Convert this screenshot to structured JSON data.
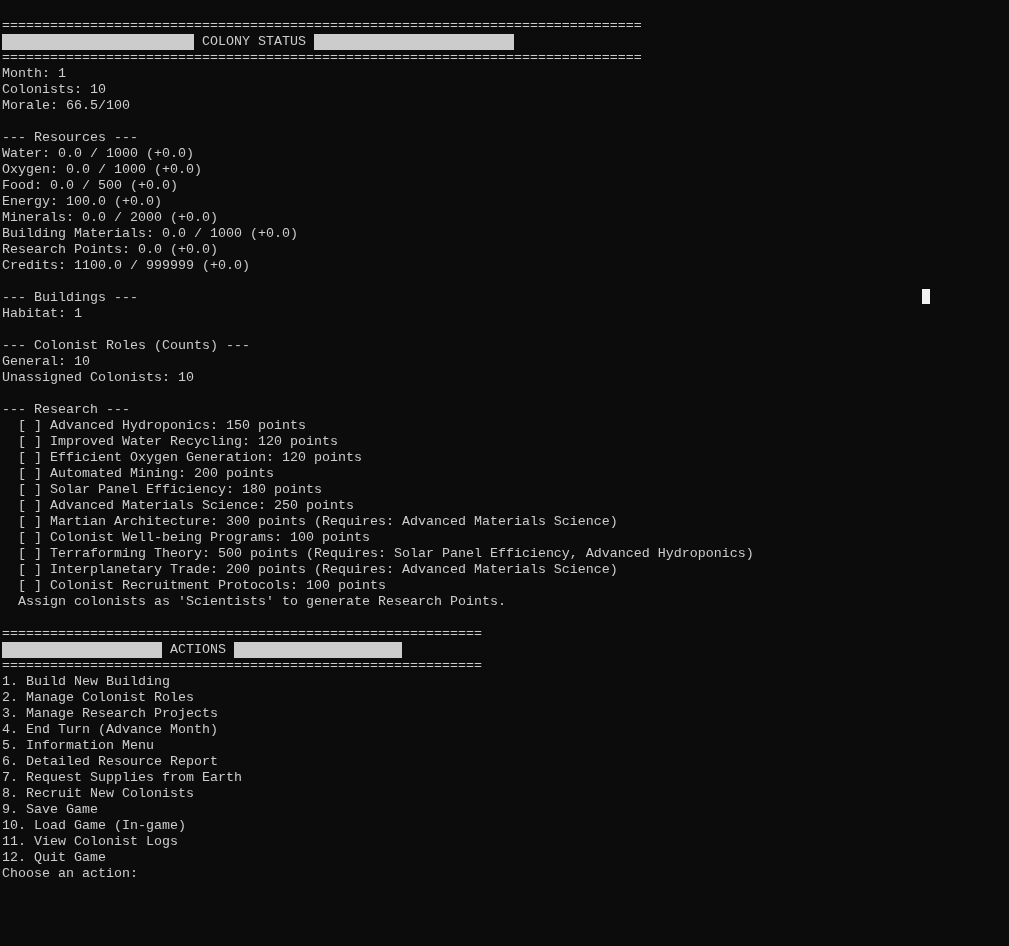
{
  "lines": [
    {
      "kind": "rule",
      "text": "================================================================================"
    },
    {
      "kind": "banner",
      "text": "COLONY STATUS"
    },
    {
      "kind": "rule",
      "text": "================================================================================"
    },
    {
      "kind": "text",
      "text": "Month: 1"
    },
    {
      "kind": "text",
      "text": "Colonists: 10"
    },
    {
      "kind": "text",
      "text": "Morale: 66.5/100"
    },
    {
      "kind": "blank"
    },
    {
      "kind": "text",
      "text": "--- Resources ---"
    },
    {
      "kind": "text",
      "text": "Water: 0.0 / 1000 (+0.0)"
    },
    {
      "kind": "text",
      "text": "Oxygen: 0.0 / 1000 (+0.0)"
    },
    {
      "kind": "text",
      "text": "Food: 0.0 / 500 (+0.0)"
    },
    {
      "kind": "text",
      "text": "Energy: 100.0 (+0.0)"
    },
    {
      "kind": "text",
      "text": "Minerals: 0.0 / 2000 (+0.0)"
    },
    {
      "kind": "text",
      "text": "Building Materials: 0.0 / 1000 (+0.0)"
    },
    {
      "kind": "text",
      "text": "Research Points: 0.0 (+0.0)"
    },
    {
      "kind": "text",
      "text": "Credits: 1100.0 / 999999 (+0.0)"
    },
    {
      "kind": "blank"
    },
    {
      "kind": "text",
      "text": "--- Buildings ---"
    },
    {
      "kind": "text",
      "text": "Habitat: 1"
    },
    {
      "kind": "blank"
    },
    {
      "kind": "text",
      "text": "--- Colonist Roles (Counts) ---"
    },
    {
      "kind": "text",
      "text": "General: 10"
    },
    {
      "kind": "text",
      "text": "Unassigned Colonists: 10"
    },
    {
      "kind": "blank"
    },
    {
      "kind": "text",
      "text": "--- Research ---"
    },
    {
      "kind": "text",
      "text": "  [ ] Advanced Hydroponics: 150 points"
    },
    {
      "kind": "text",
      "text": "  [ ] Improved Water Recycling: 120 points"
    },
    {
      "kind": "text",
      "text": "  [ ] Efficient Oxygen Generation: 120 points"
    },
    {
      "kind": "text",
      "text": "  [ ] Automated Mining: 200 points"
    },
    {
      "kind": "text",
      "text": "  [ ] Solar Panel Efficiency: 180 points"
    },
    {
      "kind": "text",
      "text": "  [ ] Advanced Materials Science: 250 points"
    },
    {
      "kind": "text",
      "text": "  [ ] Martian Architecture: 300 points (Requires: Advanced Materials Science)"
    },
    {
      "kind": "text",
      "text": "  [ ] Colonist Well-being Programs: 100 points"
    },
    {
      "kind": "text",
      "text": "  [ ] Terraforming Theory: 500 points (Requires: Solar Panel Efficiency, Advanced Hydroponics)"
    },
    {
      "kind": "text",
      "text": "  [ ] Interplanetary Trade: 200 points (Requires: Advanced Materials Science)"
    },
    {
      "kind": "text",
      "text": "  [ ] Colonist Recruitment Protocols: 100 points"
    },
    {
      "kind": "text",
      "text": "  Assign colonists as 'Scientists' to generate Research Points."
    },
    {
      "kind": "blank"
    },
    {
      "kind": "rule",
      "text": "============================================================"
    },
    {
      "kind": "banner",
      "text": "ACTIONS"
    },
    {
      "kind": "rule",
      "text": "============================================================"
    },
    {
      "kind": "text",
      "text": "1. Build New Building"
    },
    {
      "kind": "text",
      "text": "2. Manage Colonist Roles"
    },
    {
      "kind": "text",
      "text": "3. Manage Research Projects"
    },
    {
      "kind": "text",
      "text": "4. End Turn (Advance Month)"
    },
    {
      "kind": "text",
      "text": "5. Information Menu"
    },
    {
      "kind": "text",
      "text": "6. Detailed Resource Report"
    },
    {
      "kind": "text",
      "text": "7. Request Supplies from Earth"
    },
    {
      "kind": "text",
      "text": "8. Recruit New Colonists"
    },
    {
      "kind": "text",
      "text": "9. Save Game"
    },
    {
      "kind": "text",
      "text": "10. Load Game (In-game)"
    },
    {
      "kind": "text",
      "text": "11. View Colonist Logs"
    },
    {
      "kind": "text",
      "text": "12. Quit Game"
    },
    {
      "kind": "prompt",
      "text": "Choose an action:"
    }
  ]
}
